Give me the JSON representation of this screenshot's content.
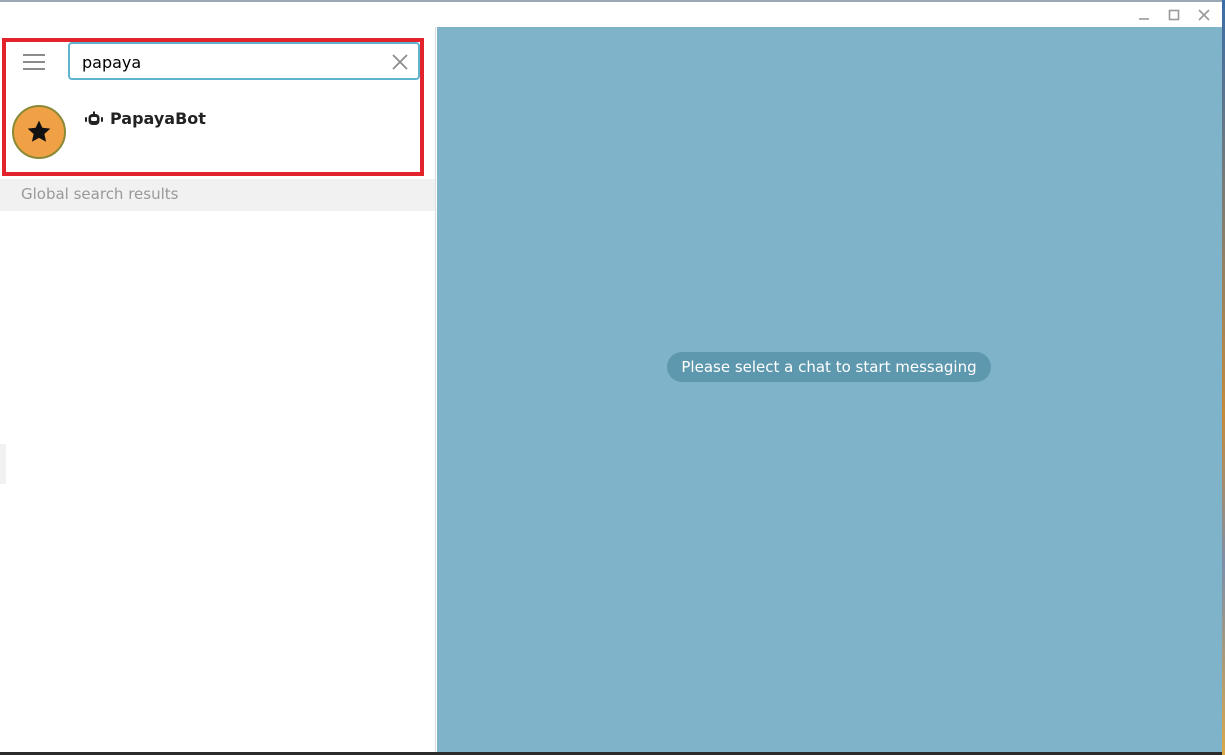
{
  "window": {
    "controls": {
      "minimize": "minimize-icon",
      "maximize": "maximize-icon",
      "close": "close-icon"
    }
  },
  "sidebar": {
    "menu_icon": "hamburger-icon",
    "search": {
      "value": "papaya",
      "clear_icon": "clear-icon"
    },
    "results": [
      {
        "name": "PapayaBot",
        "type_icon": "bot-icon",
        "avatar_icon": "star-icon",
        "avatar_color": "#f0a146"
      }
    ],
    "global_header": "Global search results"
  },
  "chat": {
    "empty_message": "Please select a chat to start messaging",
    "background_color": "#7fb3c9"
  },
  "colors": {
    "highlight": "#e3232c",
    "search_focus": "#5fb3cf"
  }
}
